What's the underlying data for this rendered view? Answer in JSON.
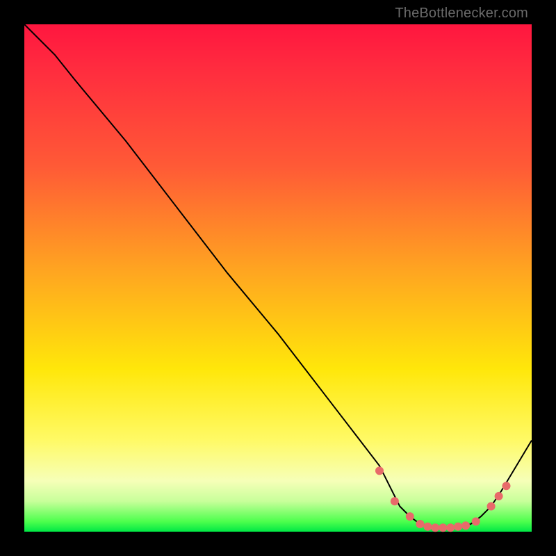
{
  "watermark": "TheBottlenecker.com",
  "chart_data": {
    "type": "line",
    "title": "",
    "xlabel": "",
    "ylabel": "",
    "xlim": [
      0,
      100
    ],
    "ylim": [
      0,
      100
    ],
    "x": [
      0,
      6,
      10,
      20,
      30,
      40,
      50,
      60,
      70,
      72,
      74,
      76,
      78,
      80,
      82,
      84,
      86,
      88,
      90,
      92,
      94,
      100
    ],
    "values": [
      100,
      94,
      89,
      77,
      64,
      51,
      39,
      26,
      13,
      9,
      5,
      3,
      1.5,
      1,
      0.8,
      0.8,
      1,
      1.5,
      3,
      5,
      8,
      18
    ],
    "markers": {
      "x": [
        70,
        73,
        76,
        78,
        79.5,
        81,
        82.5,
        84,
        85.5,
        87,
        89,
        92,
        93.5,
        95
      ],
      "y": [
        12,
        6,
        3,
        1.5,
        1,
        0.8,
        0.8,
        0.8,
        1,
        1.2,
        2,
        5,
        7,
        9
      ],
      "color": "#e86a6a",
      "radius": 6
    },
    "line_color": "#000000",
    "line_width": 2
  }
}
